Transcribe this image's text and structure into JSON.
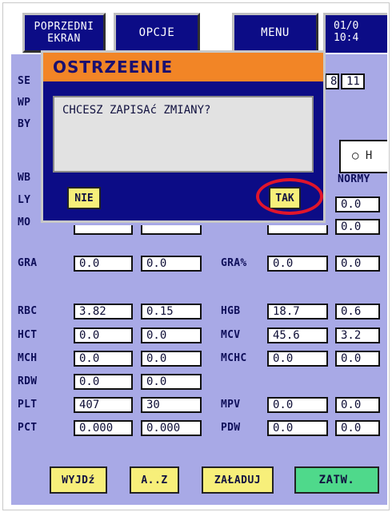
{
  "nav": {
    "prev_screen": "POPRZEDNI EKRAN",
    "options": "OPCJE",
    "menu": "MENU",
    "datetime": "01/0\n10:4"
  },
  "dialog": {
    "title": "OSTRZEENIE",
    "message": "CHCESZ ZAPISAć ZMIANY?",
    "no_label": "NIE",
    "yes_label": "TAK"
  },
  "partial": {
    "se": "SE",
    "wp": "WP",
    "by": "BY",
    "wb": "WB",
    "ly": "LY",
    "mo": "MO",
    "field_8": "8",
    "field_11": "11",
    "radio_h": "○ H",
    "normy": "NORMY"
  },
  "rows": [
    {
      "label": "GRA",
      "v1": "0.0",
      "v2": "0.0",
      "label2": "GRA%",
      "v3": "0.0",
      "v4": "0.0"
    },
    {
      "label": "RBC",
      "v1": "3.82",
      "v2": "0.15",
      "label2": "HGB",
      "v3": "18.7",
      "v4": "0.6"
    },
    {
      "label": "HCT",
      "v1": "0.0",
      "v2": "0.0",
      "label2": "MCV",
      "v3": "45.6",
      "v4": "3.2"
    },
    {
      "label": "MCH",
      "v1": "0.0",
      "v2": "0.0",
      "label2": "MCHC",
      "v3": "0.0",
      "v4": "0.0"
    },
    {
      "label": "RDW",
      "v1": "0.0",
      "v2": "0.0",
      "label2": "",
      "v3": "",
      "v4": ""
    },
    {
      "label": "PLT",
      "v1": "407",
      "v2": "30",
      "label2": "MPV",
      "v3": "0.0",
      "v4": "0.0"
    },
    {
      "label": "PCT",
      "v1": "0.000",
      "v2": "0.000",
      "label2": "PDW",
      "v3": "0.0",
      "v4": "0.0"
    }
  ],
  "partial_rows": {
    "ly_right": "0.0",
    "mo_right": "0.0"
  },
  "bottom": {
    "exit": "WYJDź",
    "az": "A..Z",
    "load": "ZAŁADUJ",
    "confirm": "ZATW."
  }
}
